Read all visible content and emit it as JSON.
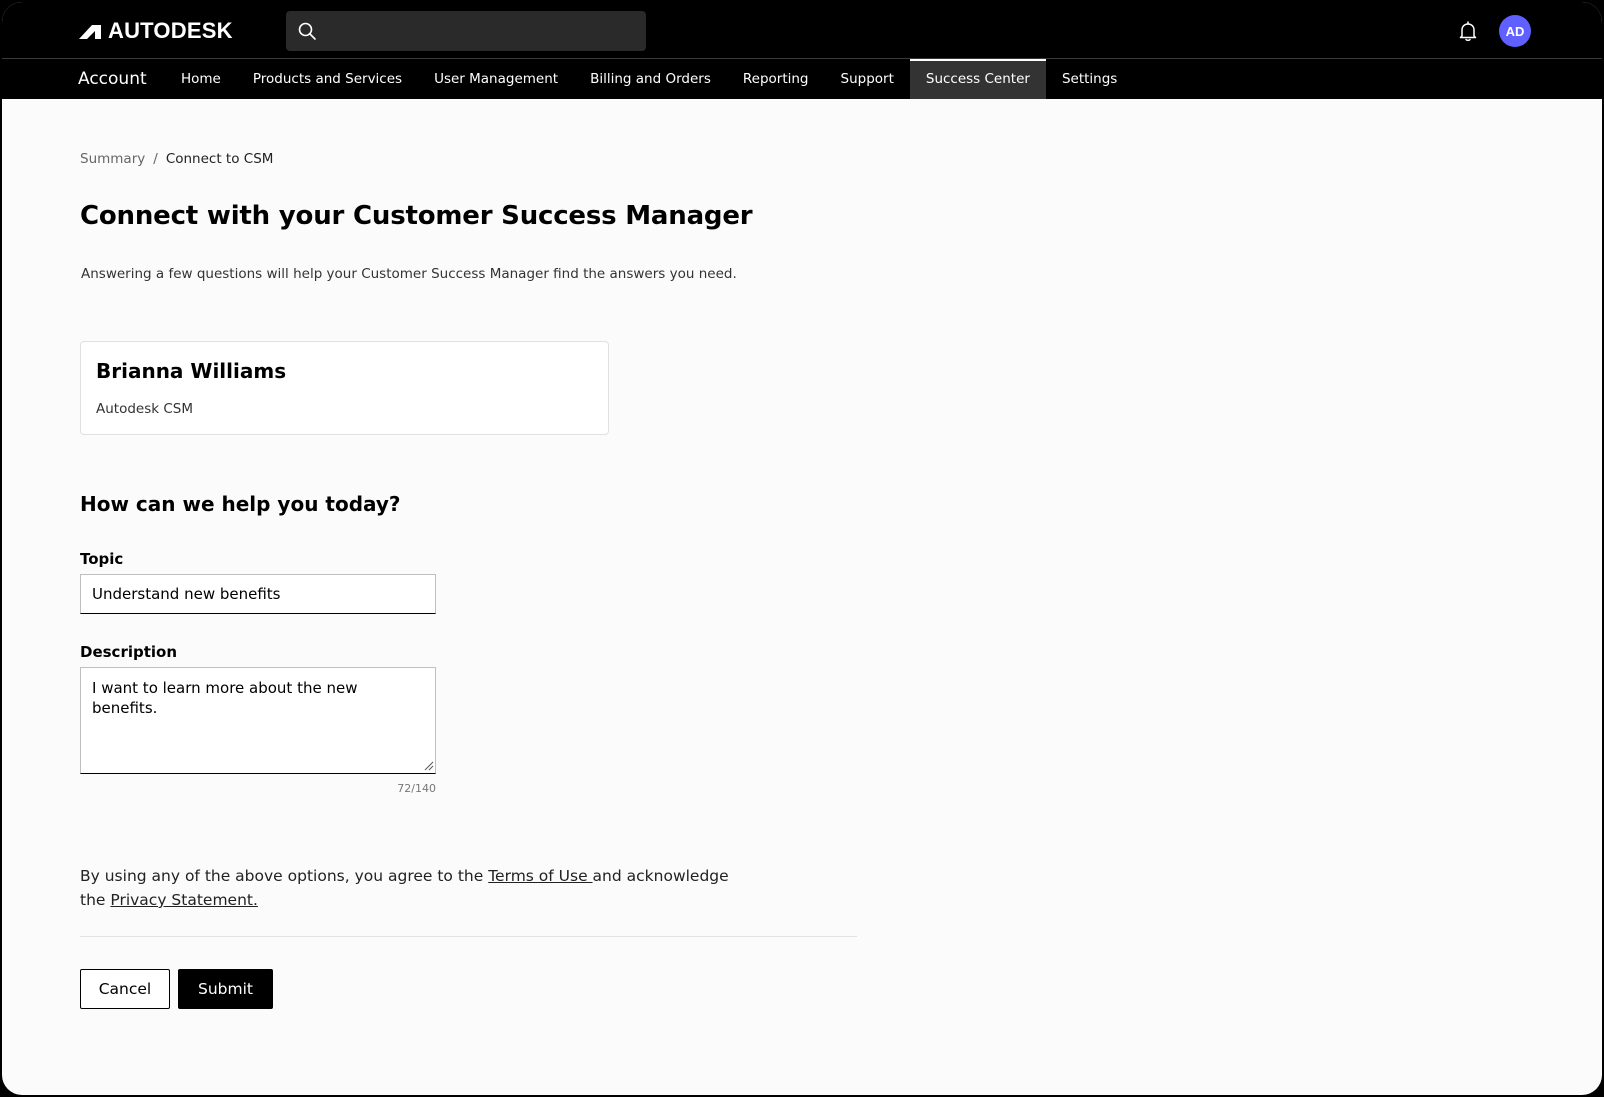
{
  "header": {
    "brand": "AUTODESK",
    "search": {
      "placeholder": "",
      "value": ""
    },
    "avatar_initials": "AD",
    "icons": [
      "autodesk-logo-icon",
      "search-icon",
      "bell-icon"
    ]
  },
  "nav": {
    "brand": "Account",
    "items": [
      {
        "label": "Home",
        "active": false
      },
      {
        "label": "Products and Services",
        "active": false
      },
      {
        "label": "User Management",
        "active": false
      },
      {
        "label": "Billing and Orders",
        "active": false
      },
      {
        "label": "Reporting",
        "active": false
      },
      {
        "label": "Support",
        "active": false
      },
      {
        "label": "Success Center",
        "active": true
      },
      {
        "label": "Settings",
        "active": false
      }
    ]
  },
  "breadcrumb": {
    "items": [
      "Summary",
      "Connect to CSM"
    ],
    "separator": "/"
  },
  "page": {
    "title": "Connect with your Customer Success Manager",
    "intro": "Answering a few questions will help your Customer Success Manager find the answers you need."
  },
  "csm": {
    "name": "Brianna Williams",
    "role": "Autodesk CSM"
  },
  "form": {
    "heading": "How can we help you today?",
    "topic": {
      "label": "Topic",
      "value": "Understand new benefits"
    },
    "description": {
      "label": "Description",
      "value": "I want to learn more about the new benefits.",
      "char_count": "72/140"
    }
  },
  "legal": {
    "prefix": "By using any of the above options, you agree to the ",
    "terms_link": "Terms of Use ",
    "middle": "and acknowledge the ",
    "privacy_link": "Privacy Statement."
  },
  "actions": {
    "cancel": "Cancel",
    "submit": "Submit"
  },
  "colors": {
    "accent_avatar": "#5f60ff",
    "header_bg": "#000000",
    "active_tab_bg": "#333333",
    "page_bg": "#fbfbfb"
  }
}
